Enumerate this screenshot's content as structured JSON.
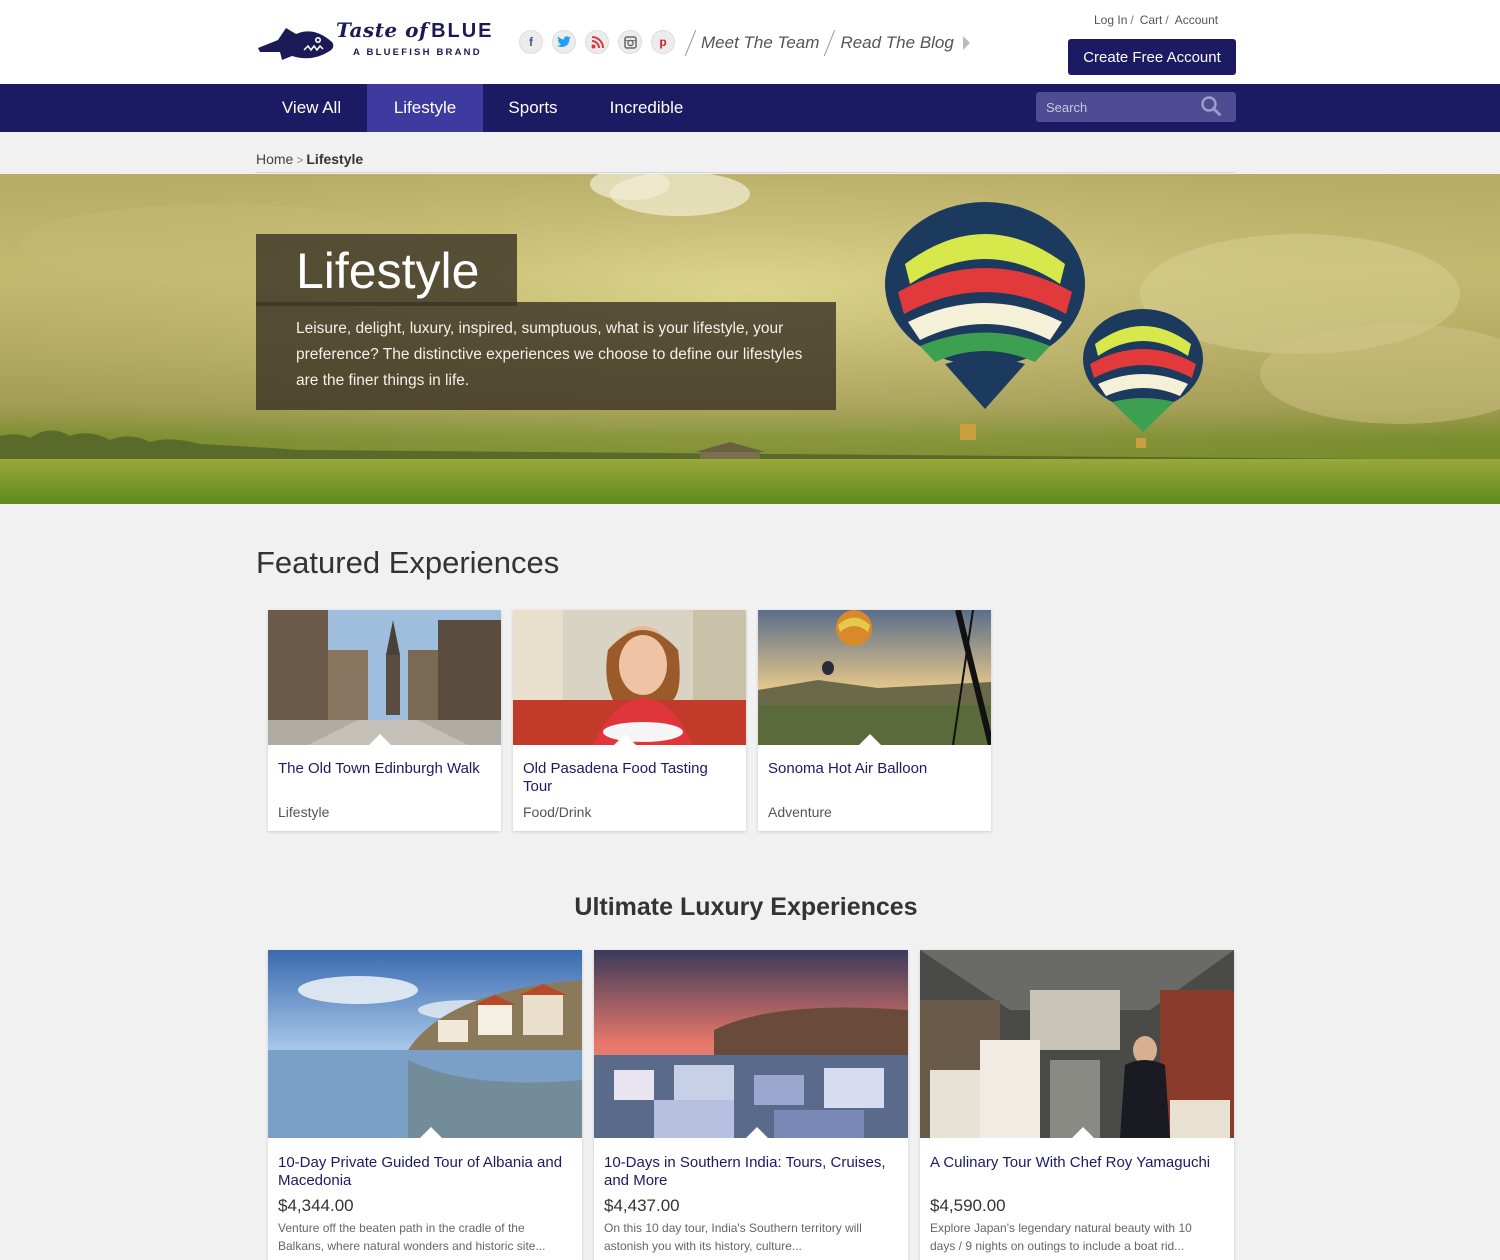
{
  "brand": {
    "title_script": "Taste of",
    "title_bold": "BLUE",
    "tagline": "A BLUEFISH BRAND"
  },
  "social_icons": [
    "facebook-icon",
    "twitter-icon",
    "rss-icon",
    "instagram-icon",
    "pinterest-icon"
  ],
  "top_links": {
    "meet_team": "Meet The Team",
    "read_blog": "Read The Blog"
  },
  "utility": {
    "login": "Log In",
    "cart": "Cart",
    "account": "Account",
    "separator": "/"
  },
  "cta": {
    "create_account": "Create Free Account"
  },
  "nav": {
    "items": [
      {
        "label": "View All"
      },
      {
        "label": "Lifestyle",
        "active": true
      },
      {
        "label": "Sports"
      },
      {
        "label": "Incredible"
      }
    ],
    "search_placeholder": "Search"
  },
  "breadcrumb": {
    "home": "Home",
    "separator": ">",
    "current": "Lifestyle"
  },
  "hero": {
    "title": "Lifestyle",
    "description": "Leisure, delight, luxury, inspired, sumptuous, what is your lifestyle, your preference? The distinctive experiences we choose to define our lifestyles are the finer things in life."
  },
  "featured": {
    "heading": "Featured Experiences",
    "cards": [
      {
        "title": "The Old Town Edinburgh Walk",
        "category": "Lifestyle"
      },
      {
        "title": "Old Pasadena Food Tasting Tour",
        "category": "Food/Drink"
      },
      {
        "title": "Sonoma Hot Air Balloon",
        "category": "Adventure"
      }
    ]
  },
  "luxury": {
    "heading": "Ultimate Luxury Experiences",
    "cards": [
      {
        "title": "10-Day Private Guided Tour of Albania and Macedonia",
        "price": "$4,344.00",
        "description": "Venture off the beaten path in the cradle of the Balkans, where natural wonders and historic site..."
      },
      {
        "title": "10-Days in Southern India: Tours, Cruises, and More",
        "price": "$4,437.00",
        "description": "On this 10 day tour, India's Southern territory will astonish you with its history, culture..."
      },
      {
        "title": "A Culinary Tour With Chef Roy Yamaguchi",
        "price": "$4,590.00",
        "description": "Explore Japan's legendary natural beauty with 10 days / 9 nights on outings to include a boat rid..."
      }
    ]
  },
  "colors": {
    "brand_navy": "#1b1a63",
    "nav_active": "#3f3aa0",
    "search_bg": "#4f4c93",
    "page_bg": "#f1f1f1",
    "link_color": "#1b1a63"
  }
}
